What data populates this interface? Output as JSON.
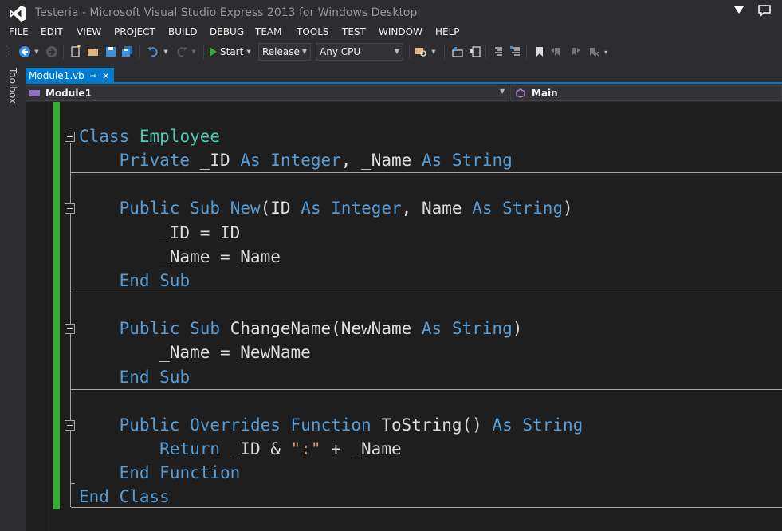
{
  "window": {
    "title": "Testeria - Microsoft Visual Studio Express 2013 for Windows Desktop"
  },
  "menu": [
    "FILE",
    "EDIT",
    "VIEW",
    "PROJECT",
    "BUILD",
    "DEBUG",
    "TEAM",
    "TOOLS",
    "TEST",
    "WINDOW",
    "HELP"
  ],
  "toolbar": {
    "start_label": "Start",
    "configuration": "Release",
    "platform": "Any CPU"
  },
  "toolbox_label": "Toolbox",
  "tab": {
    "name": "Module1.vb",
    "pin_glyph": "⊸",
    "close_glyph": "✕"
  },
  "navigation": {
    "type_selector": "Module1",
    "member_selector": "Main"
  },
  "code": {
    "lines": [
      [
        {
          "t": "kw",
          "v": "Class"
        },
        {
          "t": "pl",
          "v": " "
        },
        {
          "t": "ty",
          "v": "Employee"
        }
      ],
      [
        {
          "t": "pl",
          "v": "    "
        },
        {
          "t": "kw",
          "v": "Private"
        },
        {
          "t": "pl",
          "v": " _ID "
        },
        {
          "t": "kw",
          "v": "As"
        },
        {
          "t": "pl",
          "v": " "
        },
        {
          "t": "kw",
          "v": "Integer"
        },
        {
          "t": "pl",
          "v": ", _Name "
        },
        {
          "t": "kw",
          "v": "As"
        },
        {
          "t": "pl",
          "v": " "
        },
        {
          "t": "kw",
          "v": "String"
        }
      ],
      [],
      [
        {
          "t": "pl",
          "v": "    "
        },
        {
          "t": "kw",
          "v": "Public"
        },
        {
          "t": "pl",
          "v": " "
        },
        {
          "t": "kw",
          "v": "Sub"
        },
        {
          "t": "pl",
          "v": " "
        },
        {
          "t": "kw",
          "v": "New"
        },
        {
          "t": "pl",
          "v": "(ID "
        },
        {
          "t": "kw",
          "v": "As"
        },
        {
          "t": "pl",
          "v": " "
        },
        {
          "t": "kw",
          "v": "Integer"
        },
        {
          "t": "pl",
          "v": ", Name "
        },
        {
          "t": "kw",
          "v": "As"
        },
        {
          "t": "pl",
          "v": " "
        },
        {
          "t": "kw",
          "v": "String"
        },
        {
          "t": "pl",
          "v": ")"
        }
      ],
      [
        {
          "t": "pl",
          "v": "        _ID = ID"
        }
      ],
      [
        {
          "t": "pl",
          "v": "        _Name = Name"
        }
      ],
      [
        {
          "t": "pl",
          "v": "    "
        },
        {
          "t": "kw",
          "v": "End"
        },
        {
          "t": "pl",
          "v": " "
        },
        {
          "t": "kw",
          "v": "Sub"
        }
      ],
      [],
      [
        {
          "t": "pl",
          "v": "    "
        },
        {
          "t": "kw",
          "v": "Public"
        },
        {
          "t": "pl",
          "v": " "
        },
        {
          "t": "kw",
          "v": "Sub"
        },
        {
          "t": "pl",
          "v": " ChangeName(NewName "
        },
        {
          "t": "kw",
          "v": "As"
        },
        {
          "t": "pl",
          "v": " "
        },
        {
          "t": "kw",
          "v": "String"
        },
        {
          "t": "pl",
          "v": ")"
        }
      ],
      [
        {
          "t": "pl",
          "v": "        _Name = NewName"
        }
      ],
      [
        {
          "t": "pl",
          "v": "    "
        },
        {
          "t": "kw",
          "v": "End"
        },
        {
          "t": "pl",
          "v": " "
        },
        {
          "t": "kw",
          "v": "Sub"
        }
      ],
      [],
      [
        {
          "t": "pl",
          "v": "    "
        },
        {
          "t": "kw",
          "v": "Public"
        },
        {
          "t": "pl",
          "v": " "
        },
        {
          "t": "kw",
          "v": "Overrides"
        },
        {
          "t": "pl",
          "v": " "
        },
        {
          "t": "kw",
          "v": "Function"
        },
        {
          "t": "pl",
          "v": " ToString() "
        },
        {
          "t": "kw",
          "v": "As"
        },
        {
          "t": "pl",
          "v": " "
        },
        {
          "t": "kw",
          "v": "String"
        }
      ],
      [
        {
          "t": "pl",
          "v": "        "
        },
        {
          "t": "kw",
          "v": "Return"
        },
        {
          "t": "pl",
          "v": " _ID & "
        },
        {
          "t": "st",
          "v": "\":\""
        },
        {
          "t": "pl",
          "v": " + _Name"
        }
      ],
      [
        {
          "t": "pl",
          "v": "    "
        },
        {
          "t": "kw",
          "v": "End"
        },
        {
          "t": "pl",
          "v": " "
        },
        {
          "t": "kw",
          "v": "Function"
        }
      ],
      [
        {
          "t": "kw",
          "v": "End"
        },
        {
          "t": "pl",
          "v": " "
        },
        {
          "t": "kw",
          "v": "Class"
        }
      ]
    ]
  },
  "colors": {
    "editor_background": "#1e1e1e",
    "chrome_background": "#2d2d30",
    "keyword": "#569cd6",
    "type": "#4ec9b0",
    "string": "#d69d85",
    "plain": "#dcdcdc",
    "accent": "#007acc",
    "change_bar": "#2fb32f"
  }
}
